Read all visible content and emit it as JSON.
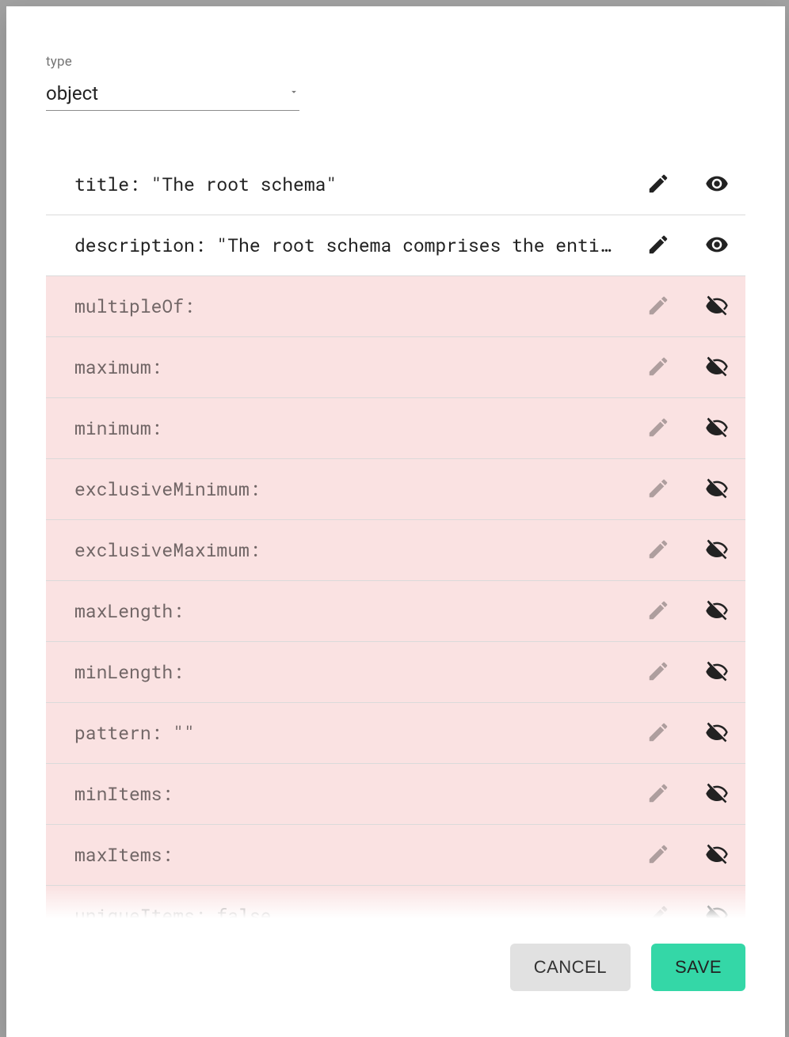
{
  "typeField": {
    "label": "type",
    "value": "object"
  },
  "rows": [
    {
      "key": "title",
      "value": "\"The root schema\"",
      "active": true
    },
    {
      "key": "description",
      "value": "\"The root schema comprises the enti…",
      "active": true
    },
    {
      "key": "multipleOf",
      "value": "",
      "active": false
    },
    {
      "key": "maximum",
      "value": "",
      "active": false
    },
    {
      "key": "minimum",
      "value": "",
      "active": false
    },
    {
      "key": "exclusiveMinimum",
      "value": "",
      "active": false
    },
    {
      "key": "exclusiveMaximum",
      "value": "",
      "active": false
    },
    {
      "key": "maxLength",
      "value": "",
      "active": false
    },
    {
      "key": "minLength",
      "value": "",
      "active": false
    },
    {
      "key": "pattern",
      "value": "\"\"",
      "active": false
    },
    {
      "key": "minItems",
      "value": "",
      "active": false
    },
    {
      "key": "maxItems",
      "value": "",
      "active": false
    },
    {
      "key": "uniqueItems",
      "value": "false",
      "active": false
    }
  ],
  "footer": {
    "cancel": "Cancel",
    "save": "Save"
  }
}
